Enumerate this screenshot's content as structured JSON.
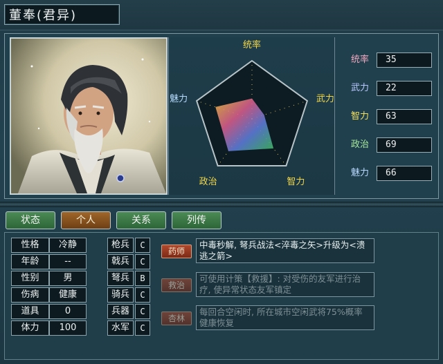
{
  "header": {
    "title": "董奉(君异)"
  },
  "radar": {
    "labels": [
      "统率",
      "武力",
      "智力",
      "政治",
      "魅力"
    ],
    "values": [
      35,
      22,
      63,
      69,
      66
    ],
    "max": 100,
    "colors": {
      "label": "#f4d84a",
      "label_left": "#b8dcff"
    }
  },
  "stats": [
    {
      "label": "统率",
      "value": "35",
      "color": "#f0a8c0"
    },
    {
      "label": "武力",
      "value": "22",
      "color": "#b8c8ff"
    },
    {
      "label": "智力",
      "value": "63",
      "color": "#f4e060"
    },
    {
      "label": "政治",
      "value": "69",
      "color": "#a8e8a0"
    },
    {
      "label": "魅力",
      "value": "66",
      "color": "#b8d8ff"
    }
  ],
  "tabs": [
    {
      "label": "状态",
      "active": false
    },
    {
      "label": "个人",
      "active": true
    },
    {
      "label": "关系",
      "active": false
    },
    {
      "label": "列传",
      "active": false
    }
  ],
  "personal": [
    {
      "label": "性格",
      "value": "冷静"
    },
    {
      "label": "年龄",
      "value": "--"
    },
    {
      "label": "性别",
      "value": "男"
    },
    {
      "label": "伤病",
      "value": "健康"
    },
    {
      "label": "道具",
      "value": "0"
    },
    {
      "label": "体力",
      "value": "100"
    }
  ],
  "troops": [
    {
      "label": "枪兵",
      "grade": "C"
    },
    {
      "label": "戟兵",
      "grade": "C"
    },
    {
      "label": "弩兵",
      "grade": "B"
    },
    {
      "label": "骑兵",
      "grade": "C"
    },
    {
      "label": "兵器",
      "grade": "C"
    },
    {
      "label": "水军",
      "grade": "C"
    }
  ],
  "skills": [
    {
      "name": "药师",
      "desc": "中毒秒解, 弩兵战法<淬毒之矢>升级为<溃逃之箭>",
      "active": true
    },
    {
      "name": "救治",
      "desc": "可使用计策【救援】: 对受伤的友军进行治疗, 使异常状态友军镇定",
      "active": false
    },
    {
      "name": "杏林",
      "desc": "每回合空闲时, 所在城市空闲武将75%概率健康恢复",
      "active": false
    }
  ],
  "colors": {
    "accent_tab": "#8a521e",
    "tab_green": "#3d7a47",
    "bg": "#21404d"
  }
}
